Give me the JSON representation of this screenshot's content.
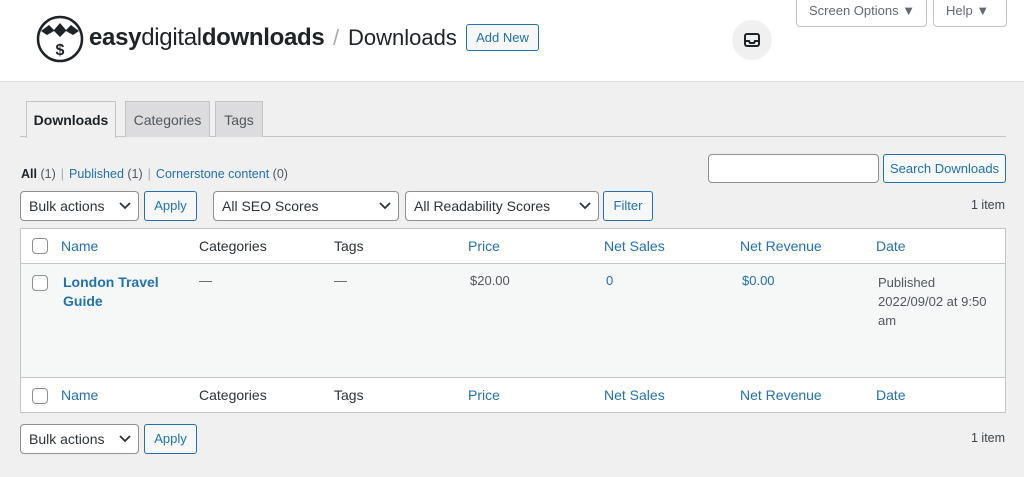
{
  "header": {
    "brand_bold1": "easy",
    "brand_thin": "digital",
    "brand_bold2": "downloads",
    "separator": "/",
    "page_title": "Downloads",
    "add_new": "Add New",
    "inbox_icon": "inbox-icon",
    "logo_icon": "edd-logo-icon"
  },
  "screen_meta": {
    "screen_options": "Screen Options ▼",
    "help": "Help ▼"
  },
  "tabs": [
    {
      "label": "Downloads",
      "active": true
    },
    {
      "label": "Categories",
      "active": false
    },
    {
      "label": "Tags",
      "active": false
    }
  ],
  "views": {
    "all": "All",
    "all_count": "(1)",
    "published": "Published",
    "published_count": "(1)",
    "cornerstone": "Cornerstone content",
    "cornerstone_count": "(0)",
    "pipe": "|"
  },
  "search": {
    "value": "",
    "button": "Search Downloads"
  },
  "filters_top": {
    "bulk_actions": "Bulk actions",
    "apply": "Apply",
    "seo_scores": "All SEO Scores",
    "readability_scores": "All Readability Scores",
    "filter": "Filter",
    "items_count": "1 item"
  },
  "table": {
    "columns": [
      "Name",
      "Categories",
      "Tags",
      "Price",
      "Net Sales",
      "Net Revenue",
      "Date"
    ],
    "rows": [
      {
        "name": "London Travel Guide",
        "categories": "—",
        "tags": "—",
        "price": "$20.00",
        "net_sales": "0",
        "net_revenue": "$0.00",
        "date": "Published 2022/09/02 at 9:50 am"
      }
    ]
  },
  "filters_bottom": {
    "bulk_actions": "Bulk actions",
    "apply": "Apply",
    "items_count": "1 item"
  },
  "colors": {
    "accent": "#2271b1",
    "background": "#f0f0f1",
    "header_bg": "#ffffff",
    "row_bg": "#f6f7f7"
  }
}
